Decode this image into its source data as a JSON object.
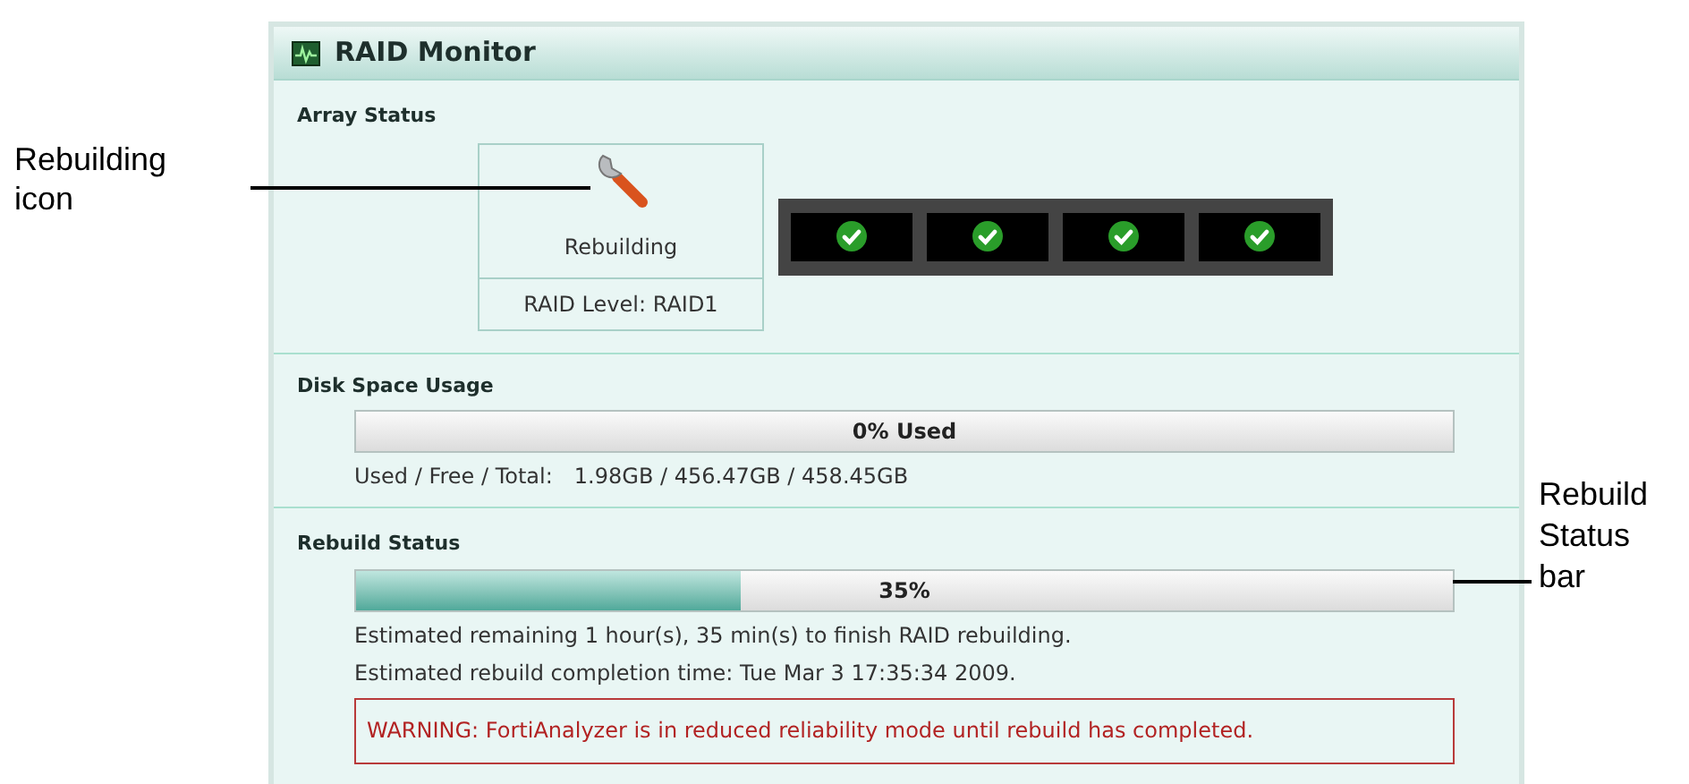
{
  "left_callout": {
    "lines": [
      "Rebuilding",
      "icon"
    ]
  },
  "right_callout": {
    "lines": [
      "Rebuild",
      "Status",
      "bar"
    ]
  },
  "panel": {
    "title": "RAID Monitor"
  },
  "array_status": {
    "label": "Array Status",
    "state": "Rebuilding",
    "raid_level": "RAID Level: RAID1",
    "disks": [
      {
        "healthy": true
      },
      {
        "healthy": true
      },
      {
        "healthy": true
      },
      {
        "healthy": true
      }
    ]
  },
  "disk_space": {
    "label": "Disk Space Usage",
    "bar_text": "0% Used",
    "level": 0,
    "details_label": "Used / Free / Total:",
    "details_value": "1.98GB / 456.47GB / 458.45GB"
  },
  "rebuild_status": {
    "label": "Rebuild Status",
    "bar_text": "35%",
    "level": 0.35,
    "lines": [
      "Estimated remaining 1 hour(s), 35 min(s) to finish RAID rebuilding.",
      "Estimated rebuild completion time: Tue Mar 3 17:35:34 2009."
    ],
    "warning": "WARNING: FortiAnalyzer is in reduced reliability mode until rebuild has completed."
  }
}
